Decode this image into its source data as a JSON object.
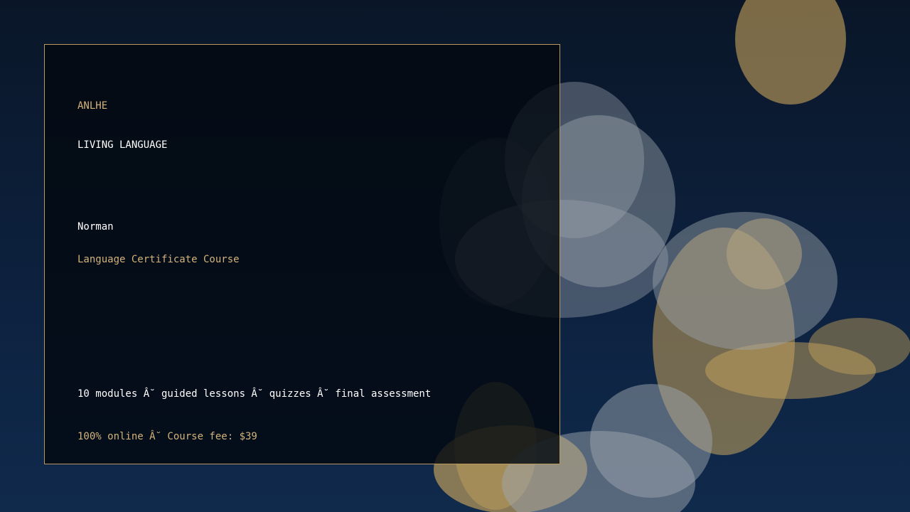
{
  "colors": {
    "background_top": "#0a1628",
    "background_bottom": "#102a4c",
    "accent_gold": "#d4b27a",
    "card_border": "#b89a5e",
    "text_white": "#ffffff",
    "bokeh_gold": "#c8a45c",
    "bokeh_grey": "#9ea6ae"
  },
  "card": {
    "brand": "ANLHE",
    "tagline": "LIVING LANGUAGE",
    "name": "Norman",
    "course_title": "Language Certificate Course",
    "details": "10 modules Â˘ guided lessons Â˘ quizzes Â˘ final assessment",
    "fee_line": "100% online Â˘ Course fee: $39"
  }
}
